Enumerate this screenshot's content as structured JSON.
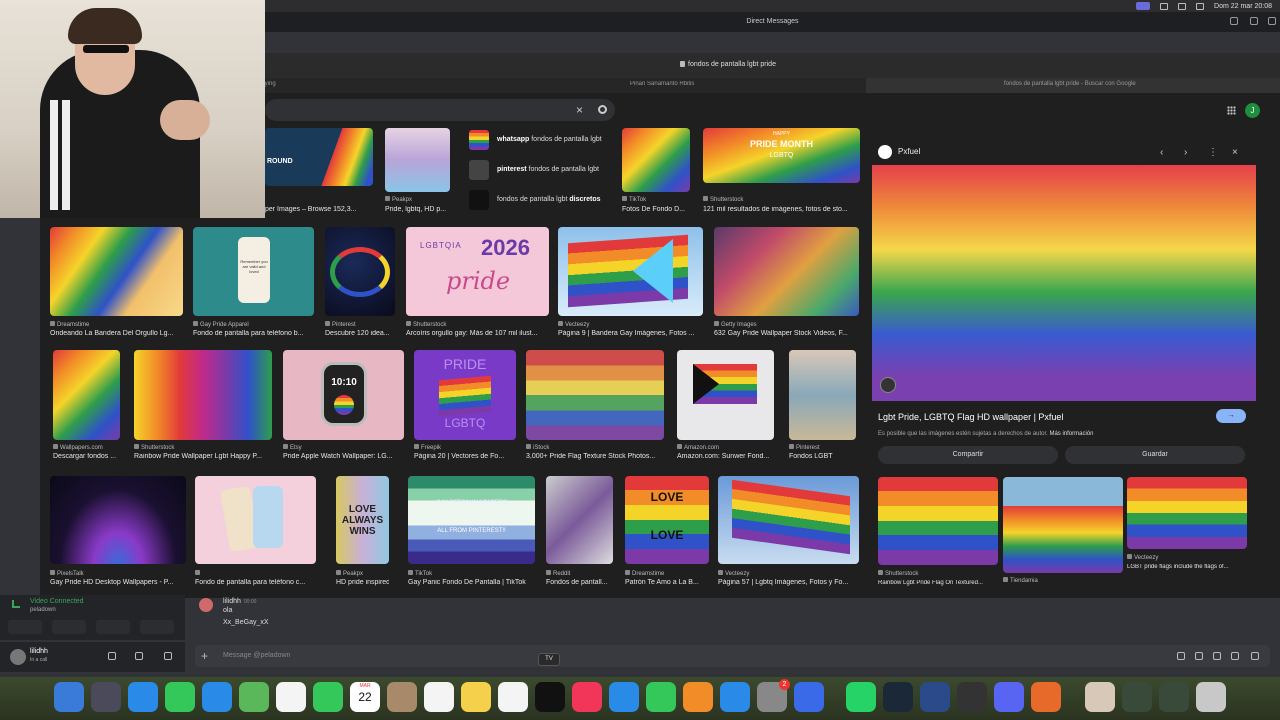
{
  "menubar": {
    "clock": "Dom 22 mar  20:08"
  },
  "discord_window": {
    "title": "Direct Messages"
  },
  "browser": {
    "url": "fondos de pantalla lgbt pride",
    "tabs": [
      {
        "label": "laying"
      },
      {
        "label": "Pinan Sanamanto Hbitis"
      },
      {
        "label": "fondos de pantalla lgbt pride - Buscar con Google"
      }
    ],
    "account_initial": "J"
  },
  "search": {
    "clear_icon": "close-icon",
    "search_icon": "search-icon"
  },
  "suggestions": [
    {
      "bold": "whatsapp",
      "text": " fondos de pantalla lgbt"
    },
    {
      "bold": "pinterest",
      "text": " fondos de pantalla lgbt"
    },
    {
      "bold": "discretos",
      "pre": "fondos de pantalla lgbt "
    }
  ],
  "top_row": [
    {
      "source": "",
      "caption": "per Images – Browse 152,3..."
    },
    {
      "source": "Peakpx",
      "caption": "Pride, lgbtq, HD p..."
    },
    {
      "source": "TikTok",
      "caption": "Fotos De Fondo D..."
    },
    {
      "source": "Shutterstock",
      "caption": "121 mil resultados de imágenes, fotos de sto..."
    }
  ],
  "top_texts": {
    "round": "ROUND",
    "pride_month_top": "HAPPY",
    "pride_month": "PRIDE MONTH",
    "pride_lgbtq": "LGBTQ"
  },
  "row1": [
    {
      "source": "Dreamstime",
      "caption": "Ondeando La Bandera Del Orgullo Lg..."
    },
    {
      "source": "Gay Pride Apparel",
      "caption": "Fondo de pantalla para teléfono b..."
    },
    {
      "source": "Pinterest",
      "caption": "Descubre 120 idea..."
    },
    {
      "source": "Shutterstock",
      "caption": "Arcoíris orgullo gay: Más de 107 mil ilust..."
    },
    {
      "source": "Vecteezy",
      "caption": "Página 9 | Bandera Gay Imágenes, Fotos ..."
    },
    {
      "source": "Getty Images",
      "caption": "632 Gay Pride Wallpaper Stock Videos, F..."
    }
  ],
  "row1_texts": {
    "lgbtqia": "LGBTQIA",
    "year": "2026",
    "pride_script": "pride",
    "phone_text": "Remember you are valid and loved"
  },
  "row2": [
    {
      "source": "Wallpapers.com",
      "caption": "Descargar fondos ..."
    },
    {
      "source": "Shutterstock",
      "caption": "Rainbow Pride Wallpaper Lgbt Happy P..."
    },
    {
      "source": "Etsy",
      "caption": "Pride Apple Watch Wallpaper: LG..."
    },
    {
      "source": "Freepik",
      "caption": "Página 20 | Vectores de Fo..."
    },
    {
      "source": "iStock",
      "caption": "3,000+ Pride Flag Texture Stock Photos..."
    },
    {
      "source": "Amazon.com",
      "caption": "Amazon.com: Sunwer Fond..."
    },
    {
      "source": "Pinterest",
      "caption": "Fondos LGBT"
    }
  ],
  "row2_texts": {
    "watch_time": "10:10",
    "pride_word": "PRIDE",
    "lgbtq_word": "LGBTQ"
  },
  "row3": [
    {
      "source": "PixelsTalk",
      "caption": "Gay Pride HD Desktop Wallpapers - P..."
    },
    {
      "source": "",
      "caption": "Fondo de pantalla para teléfono c..."
    },
    {
      "source": "Peakpx",
      "caption": "HD pride inspired ..."
    },
    {
      "source": "TikTok",
      "caption": "Gay Panic Fondo De Pantalla | TikTok"
    },
    {
      "source": "Reddit",
      "caption": "Fondos de pantall..."
    },
    {
      "source": "Dreamstime",
      "caption": "Patrón Te Amo a La B..."
    },
    {
      "source": "Vecteezy",
      "caption": "Página 57 | Lgbtq Imágenes, Fotos y Fo..."
    }
  ],
  "row3_texts": {
    "love_always_wins": "LOVE ALWAYS WINS",
    "gay_pfps": "GAY PFPS/WALLPAPERS",
    "from_pinterest": "ALL FROM PINTEREST!!",
    "love": "LOVE"
  },
  "preview": {
    "site": "Pxfuel",
    "title": "Lgbt Pride, LGBTQ Flag HD wallpaper | Pxfuel",
    "note": "Es posible que las imágenes estén sujetas a derechos de autor.",
    "note_link": "Más información",
    "share": "Compartir",
    "save": "Guardar",
    "related": [
      {
        "source": "Shutterstock",
        "caption": "Rainbow Lgbt Pride Flag On Textured..."
      },
      {
        "source": "Tiendamia",
        "caption": ""
      },
      {
        "source": "Vecteezy",
        "caption": "LGBT pride flags include the flags of..."
      }
    ]
  },
  "dm": {
    "name": "lilidhh",
    "time": "00:00",
    "line1": "ola",
    "line2": "Xx_BeGay_xX"
  },
  "voice": {
    "status": "Video Connected",
    "channel": "peladown"
  },
  "user": {
    "name": "lilidhh",
    "status": "In a call"
  },
  "composer": {
    "placeholder": "Message @peladown"
  },
  "tooltip": "TV",
  "dock": {
    "calendar_month": "MAR",
    "calendar_day": "22",
    "settings_badge": "2"
  }
}
